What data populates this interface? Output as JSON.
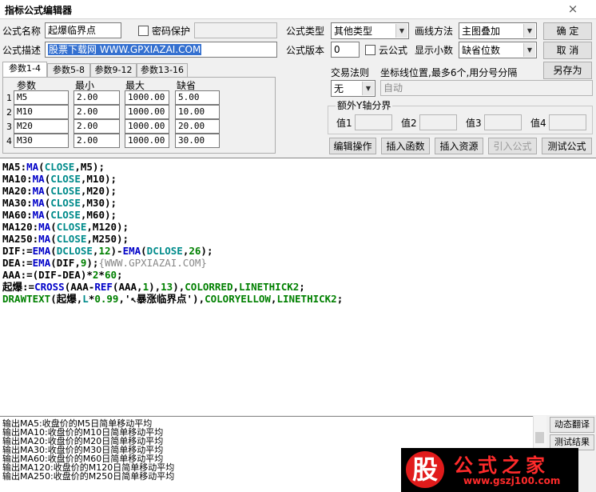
{
  "window": {
    "title": "指标公式编辑器",
    "close_icon": "×"
  },
  "form": {
    "name_label": "公式名称",
    "name_value": "起爆临界点",
    "password_label": "密码保护",
    "password_value": "",
    "type_label": "公式类型",
    "type_value": "其他类型",
    "draw_method_label": "画线方法",
    "draw_method_value": "主图叠加",
    "desc_label": "公式描述",
    "desc_value": "股票下载网 WWW.GPXIAZAI.COM",
    "version_label": "公式版本",
    "version_value": "0",
    "cloud_label": "云公式",
    "decimals_label": "显示小数",
    "decimals_value": "缺省位数"
  },
  "buttons": {
    "ok": "确  定",
    "cancel": "取  消",
    "save_as": "另存为",
    "edit_ops": "编辑操作",
    "insert_func": "插入函数",
    "insert_res": "插入资源",
    "import_formula": "引入公式",
    "test_formula": "测试公式",
    "dyn_translate": "动态翻译",
    "test_result": "测试结果"
  },
  "tabs": [
    "参数1-4",
    "参数5-8",
    "参数9-12",
    "参数13-16"
  ],
  "params": {
    "headers": [
      "参数",
      "最小",
      "最大",
      "缺省"
    ],
    "rows": [
      {
        "idx": "1",
        "name": "M5",
        "min": "2.00",
        "max": "1000.00",
        "def": "5.00"
      },
      {
        "idx": "2",
        "name": "M10",
        "min": "2.00",
        "max": "1000.00",
        "def": "10.00"
      },
      {
        "idx": "3",
        "name": "M20",
        "min": "2.00",
        "max": "1000.00",
        "def": "20.00"
      },
      {
        "idx": "4",
        "name": "M30",
        "min": "2.00",
        "max": "1000.00",
        "def": "30.00"
      }
    ]
  },
  "trade": {
    "rule_label": "交易法则",
    "rule_value": "无",
    "axis_label": "坐标线位置,最多6个,用分号分隔",
    "axis_value": "自动",
    "extra_y_label": "额外Y轴分界",
    "values": [
      "值1",
      "值2",
      "值3",
      "值4"
    ]
  },
  "output": [
    "输出MA5:收盘价的M5日简单移动平均",
    "输出MA10:收盘价的M10日简单移动平均",
    "输出MA20:收盘价的M20日简单移动平均",
    "输出MA30:收盘价的M30日简单移动平均",
    "输出MA60:收盘价的M60日简单移动平均",
    "输出MA120:收盘价的M120日简单移动平均",
    "输出MA250:收盘价的M250日简单移动平均"
  ],
  "logo": {
    "char": "股",
    "text": "公式之家",
    "url": "www.gszj100.com"
  },
  "colors": {
    "code_blue": "#0000c8",
    "code_cyan": "#008b8b",
    "code_green": "#008000",
    "logo_red": "#e11b1b"
  }
}
